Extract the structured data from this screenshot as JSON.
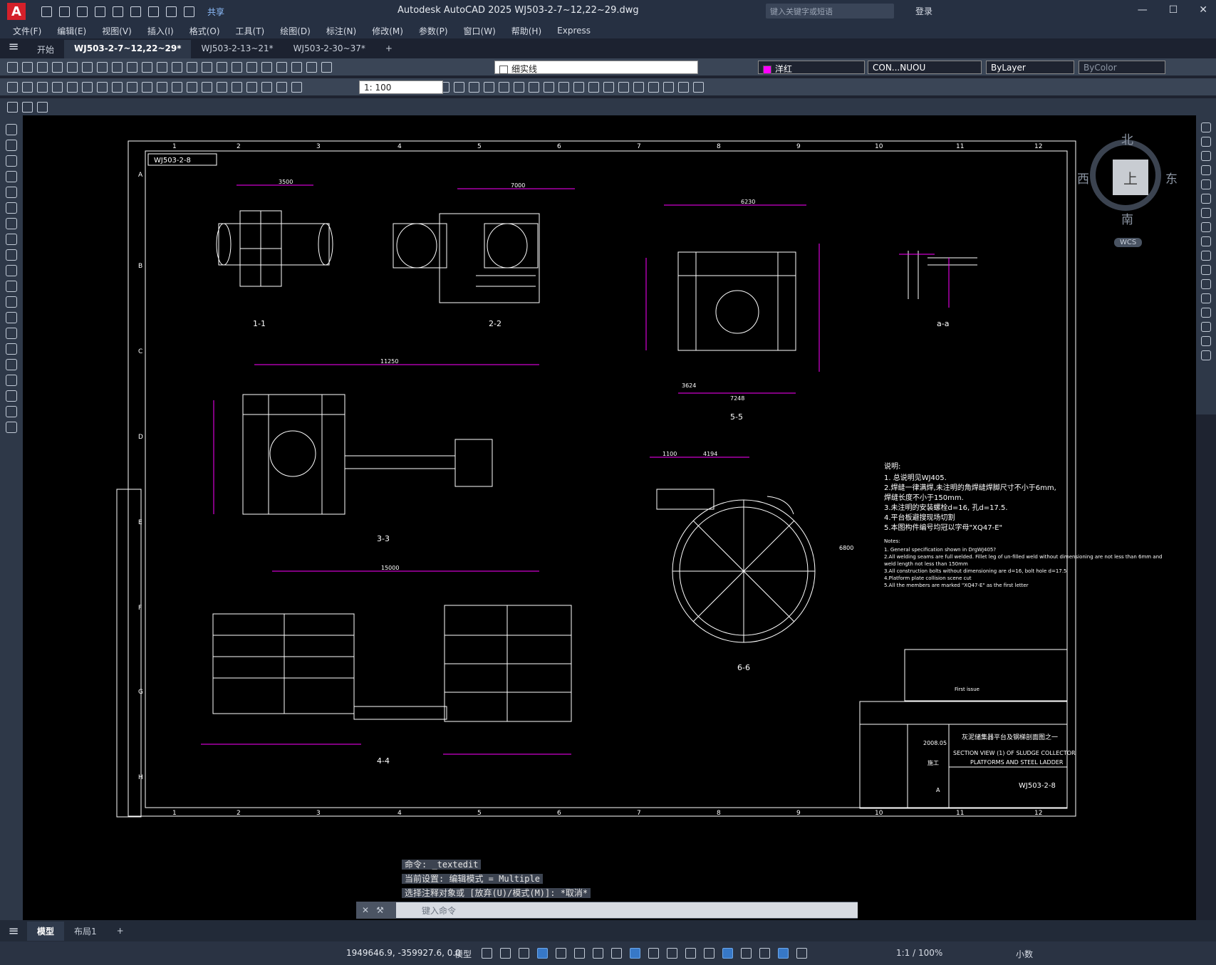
{
  "app": {
    "logo": "A",
    "share": "共享",
    "title": "Autodesk AutoCAD 2025    WJ503-2-7~12,22~29.dwg",
    "search_placeholder": "键入关键字或短语",
    "login": "登录"
  },
  "menu": [
    "文件(F)",
    "编辑(E)",
    "视图(V)",
    "插入(I)",
    "格式(O)",
    "工具(T)",
    "绘图(D)",
    "标注(N)",
    "修改(M)",
    "参数(P)",
    "窗口(W)",
    "帮助(H)",
    "Express"
  ],
  "tabs": [
    {
      "label": "开始",
      "active": false
    },
    {
      "label": "WJ503-2-7~12,22~29*",
      "active": true
    },
    {
      "label": "WJ503-2-13~21*",
      "active": false
    },
    {
      "label": "WJ503-2-30~37*",
      "active": false
    }
  ],
  "props": {
    "layer": "细实线",
    "color_name": "洋红",
    "color_hex": "#ff00ff",
    "linetype": "CON...NUOU",
    "lineweight": "ByLayer",
    "plotstyle": "ByColor",
    "dimscale": "1: 100"
  },
  "viewcube": {
    "north": "北",
    "south": "南",
    "east": "东",
    "west": "西",
    "face": "上",
    "wcs": "WCS"
  },
  "drawing": {
    "sheet_id": "WJ503-2-8",
    "col_numbers": [
      "1",
      "2",
      "3",
      "4",
      "5",
      "6",
      "7",
      "8",
      "9",
      "10",
      "11",
      "12"
    ],
    "row_letters": [
      "A",
      "B",
      "C",
      "D",
      "E",
      "F",
      "G",
      "H"
    ],
    "views": [
      {
        "label": "1-1"
      },
      {
        "label": "2-2"
      },
      {
        "label": "5-5"
      },
      {
        "label": "a-a"
      },
      {
        "label": "3-3"
      },
      {
        "label": "6-6"
      },
      {
        "label": "4-4"
      }
    ],
    "dims": [
      "3500",
      "7000",
      "11250",
      "15000",
      "6230",
      "7248",
      "3624",
      "4194",
      "1100",
      "6800"
    ],
    "notes_cn_title": "说明:",
    "notes_cn": [
      "1. 总说明见WJ405.",
      "2.焊缝一律满焊,未注明的角焊缝焊脚尺寸不小于6mm,",
      "   焊缝长度不小于150mm.",
      "3.未注明的安装螺栓d=16, 孔d=17.5.",
      "4.平台板避搜现场切割",
      "5.本图构件编号均冠以字母\"XQ47-E\""
    ],
    "notes_en_title": "Notes:",
    "notes_en": [
      "1. General specification shown in DrgWJ405?",
      "2.All welding seams are full welded. Fillet leg of un-filled weld without dimensioning are not less than 6mm and",
      "   weld length not less than 150mm",
      "3.All construction bolts without dimensioning are d=16, bolt hole d=17.5",
      "4.Platform plate collision scene cut",
      "5.All the members are marked \"XQ47-E\" as the first letter"
    ],
    "title_block": {
      "title_cn": "灰泥储集器平台及钢梯剖面图之一",
      "title_en1": "SECTION VIEW (1) OF SLUDGE COLLECTOR",
      "title_en2": "PLATFORMS AND STEEL LADDER",
      "drawing_no": "WJ503-2-8",
      "date": "2008.05",
      "stage": "施工",
      "revision": "A",
      "first_issue": "First issue"
    }
  },
  "command": {
    "history": [
      "命令: _textedit",
      "当前设置: 编辑模式 = Multiple",
      "选择注释对象或 [放弃(U)/模式(M)]: *取消*"
    ],
    "placeholder": "键入命令"
  },
  "layout_tabs": [
    {
      "label": "模型",
      "active": true
    },
    {
      "label": "布局1",
      "active": false
    }
  ],
  "status": {
    "coords": "1949646.9, -359927.6, 0.0",
    "model": "模型",
    "scale": "1:1 / 100%",
    "units": "小数"
  }
}
